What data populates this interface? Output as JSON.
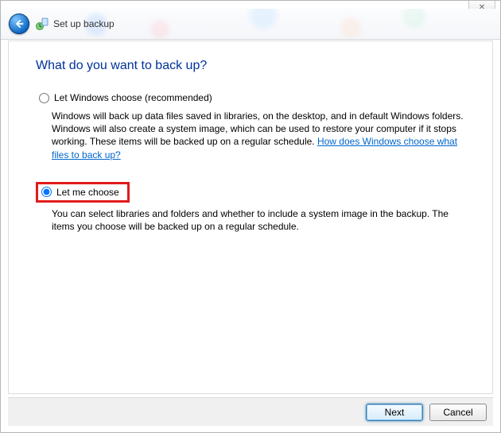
{
  "sys": {
    "close_glyph": "✕"
  },
  "header": {
    "title": "Set up backup"
  },
  "page": {
    "heading": "What do you want to back up?"
  },
  "options": {
    "choose_windows": {
      "label": "Let Windows choose (recommended)",
      "desc_prefix": "Windows will back up data files saved in libraries, on the desktop, and in default Windows folders. Windows will also create a system image, which can be used to restore your computer if it stops working. These items will be backed up on a regular schedule. ",
      "link": "How does Windows choose what files to back up?",
      "selected": false
    },
    "let_me": {
      "label": "Let me choose",
      "desc": "You can select libraries and folders and whether to include a system image in the backup. The items you choose will be backed up on a regular schedule.",
      "selected": true
    }
  },
  "footer": {
    "next": "Next",
    "cancel": "Cancel"
  }
}
